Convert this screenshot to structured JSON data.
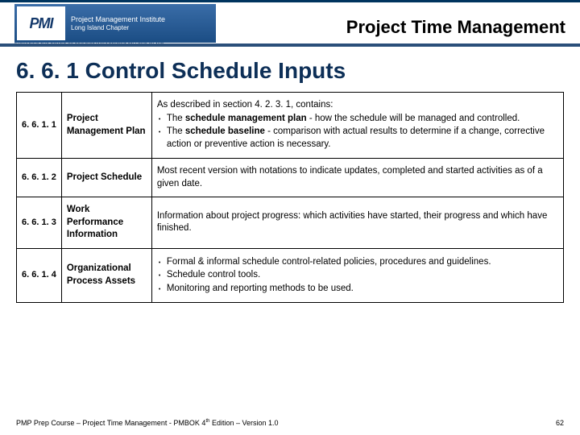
{
  "logo": {
    "badge": "PMI",
    "line1": "Project Management Institute",
    "line2": "Long Island Chapter",
    "tagline": "EXPANDING THE POWER OF PROJECT MANAGEMENT ON LONG ISLAND"
  },
  "slide_title": "Project Time Management",
  "section_title": "6. 6. 1 Control Schedule Inputs",
  "rows": [
    {
      "num": "6. 6. 1. 1",
      "name": "Project Management Plan",
      "intro": "As described in section 4. 2. 3. 1, contains:",
      "bullets": [
        {
          "bold": "schedule management plan",
          "prefix": "The ",
          "suffix": " - how the schedule will be managed and controlled."
        },
        {
          "bold": "schedule baseline",
          "prefix": "The ",
          "suffix": " - comparison with actual results to determine if a change, corrective action or preventive action is necessary."
        }
      ]
    },
    {
      "num": "6. 6. 1. 2",
      "name": "Project Schedule",
      "text": "Most recent version with notations to indicate updates, completed and started activities as of a given date."
    },
    {
      "num": "6. 6. 1. 3",
      "name": "Work Performance Information",
      "text": "Information about project progress: which activities have started, their progress and which have finished."
    },
    {
      "num": "6. 6. 1. 4",
      "name": "Organizational Process Assets",
      "bullets_plain": [
        "Formal & informal schedule control-related policies, procedures and guidelines.",
        "Schedule control tools.",
        "Monitoring and reporting methods to be used."
      ]
    }
  ],
  "footer": {
    "left_a": "PMP Prep Course – Project Time Management - PMBOK 4",
    "left_sup": "th",
    "left_b": " Edition – Version 1.0",
    "page": "62"
  }
}
